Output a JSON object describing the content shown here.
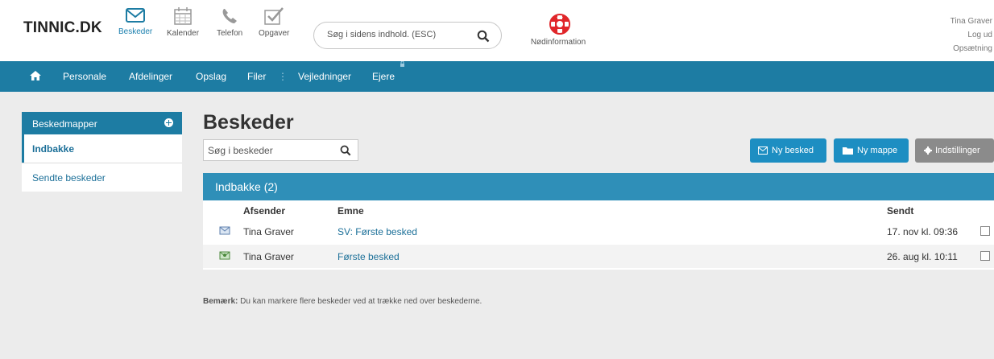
{
  "header": {
    "logo": "TINNIC.DK",
    "tools": [
      {
        "label": "Beskeder",
        "icon": "envelope-icon"
      },
      {
        "label": "Kalender",
        "icon": "calendar-icon"
      },
      {
        "label": "Telefon",
        "icon": "phone-icon"
      },
      {
        "label": "Opgaver",
        "icon": "checkbox-icon"
      }
    ],
    "search_placeholder": "Søg i sidens indhold. (ESC)",
    "emergency_label": "Nødinformation",
    "user_name": "Tina Graver",
    "logout_label": "Log ud",
    "settings_label": "Opsætning"
  },
  "nav": {
    "items": [
      "Personale",
      "Afdelinger",
      "Opslag",
      "Filer",
      "Vejledninger",
      "Ejere"
    ],
    "separator": "⋮"
  },
  "sidebar": {
    "title": "Beskedmapper",
    "items": [
      "Indbakke",
      "Sendte beskeder"
    ]
  },
  "main": {
    "title": "Beskeder",
    "search_placeholder": "Søg i beskeder",
    "buttons": {
      "new_message": "Ny besked",
      "new_folder": "Ny mappe",
      "settings": "Indstillinger"
    },
    "inbox_title": "Indbakke (2)",
    "columns": {
      "sender": "Afsender",
      "subject": "Emne",
      "sent": "Sendt"
    },
    "rows": [
      {
        "sender": "Tina Graver",
        "subject": "SV: Første besked",
        "sent": "17. nov kl. 09:36"
      },
      {
        "sender": "Tina Graver",
        "subject": "Første besked",
        "sent": "26. aug kl. 10:11"
      }
    ],
    "note_label": "Bemærk:",
    "note_text": " Du kan markere flere beskeder ved at trække ned over beskederne."
  },
  "colors": {
    "primary": "#1d7ca3",
    "button_blue": "#1d8ec2",
    "button_gray": "#8b8b8b",
    "emergency_red": "#e0262a"
  }
}
